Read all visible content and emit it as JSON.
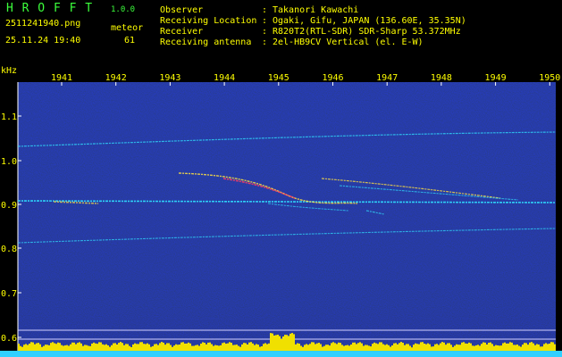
{
  "app": {
    "title": "H R O F F T",
    "version": "1.0.0"
  },
  "file": {
    "name": "2511241940.png",
    "datetime": "25.11.24 19:40"
  },
  "meteor": {
    "label": "meteor",
    "count": "61"
  },
  "info": {
    "labels": [
      "Observer",
      "Receiving Location",
      "Receiver",
      "Receiving antenna"
    ],
    "separator": ":",
    "values": [
      "Takanori Kawachi",
      "Ogaki, Gifu, JAPAN (136.60E, 35.35N)",
      "R820T2(RTL-SDR) SDR-Sharp 53.372MHz",
      "2el-HB9CV Vertical (el. E-W)"
    ]
  },
  "colors": {
    "header_text": "#ffff00",
    "title_green": "#3cff3c",
    "background_noise": "#0a0a6e",
    "signal_cyan": "#30e0ff",
    "signal_yellow": "#ffe040",
    "signal_red": "#ff4060",
    "grid_white": "#ffffff"
  },
  "spectrogram": {
    "y_unit": "kHz",
    "x_ticks": [
      "1941",
      "1942",
      "1943",
      "1944",
      "1945",
      "1946",
      "1947",
      "1948",
      "1949",
      "1950"
    ],
    "y_ticks": [
      "1.1",
      "1.0",
      "0.9",
      "0.8",
      "0.7",
      "0.6"
    ]
  }
}
